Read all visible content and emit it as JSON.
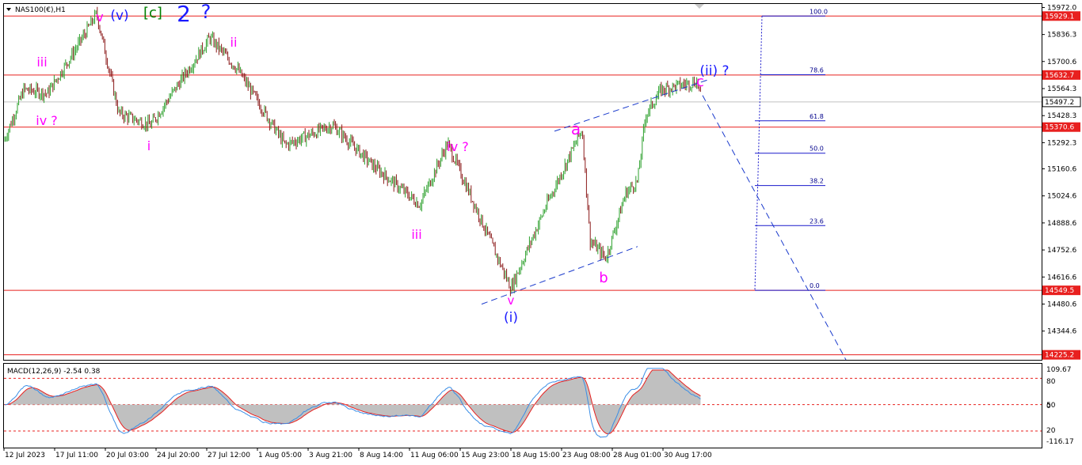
{
  "chart_data": {
    "type": "candlestick",
    "symbol_label": "NAS100(€),H1",
    "title_annotation": {
      "parts": [
        {
          "text": "v",
          "color": "#ff00ff"
        },
        {
          "text": "(v)",
          "color": "#1a1aff"
        },
        {
          "text": "[c]",
          "color": "#008000"
        },
        {
          "text": "2",
          "color": "#1a1aff"
        },
        {
          "text": "?",
          "color": "#1a1aff"
        }
      ]
    },
    "x_tick_labels": [
      "12 Jul 2023",
      "17 Jul 11:00",
      "20 Jul 03:00",
      "24 Jul 20:00",
      "27 Jul 12:00",
      "1 Aug 05:00",
      "3 Aug 21:00",
      "8 Aug 14:00",
      "11 Aug 06:00",
      "15 Aug 23:00",
      "18 Aug 15:00",
      "23 Aug 08:00",
      "28 Aug 01:00",
      "30 Aug 17:00"
    ],
    "y_ticks": [
      15972.0,
      15836.3,
      15700.6,
      15564.3,
      15428.3,
      15292.3,
      15160.6,
      15024.6,
      14888.6,
      14752.6,
      14616.6,
      14480.6,
      14344.6
    ],
    "y_tick_labels": [
      "15972.0",
      "15836.3",
      "15700.6",
      "15564.3",
      "15428.3",
      "15292.3",
      "15160.6",
      "15024.6",
      "14888.6",
      "14752.6",
      "14616.6",
      "14480.6",
      "14344.6"
    ],
    "ylim": [
      14200,
      15990
    ],
    "horizontal_levels": [
      {
        "value": 15929.1,
        "label": "15929.1",
        "color": "#e8201f"
      },
      {
        "value": 15632.7,
        "label": "15632.7",
        "color": "#e8201f"
      },
      {
        "value": 15370.6,
        "label": "15370.6",
        "color": "#e8201f"
      },
      {
        "value": 14549.5,
        "label": "14549.5",
        "color": "#e8201f"
      },
      {
        "value": 14225.2,
        "label": "14225.2",
        "color": "#e8201f"
      }
    ],
    "current_price": {
      "value": 15497.2,
      "label": "15497.2"
    },
    "fibonacci": {
      "high": 15929.1,
      "low": 14549.5,
      "levels": [
        {
          "ratio": 100.0,
          "label": "100.0"
        },
        {
          "ratio": 78.6,
          "label": "78.6"
        },
        {
          "ratio": 61.8,
          "label": "61.8"
        },
        {
          "ratio": 50.0,
          "label": "50.0"
        },
        {
          "ratio": 38.2,
          "label": "38.2"
        },
        {
          "ratio": 23.6,
          "label": "23.6"
        },
        {
          "ratio": 0.0,
          "label": "0.0"
        }
      ]
    },
    "wave_labels": [
      {
        "text": "iii",
        "color": "#ff00ff",
        "near": "17 Jul high"
      },
      {
        "text": "iv ?",
        "color": "#ff00ff",
        "near": "14 Jul low"
      },
      {
        "text": "i",
        "color": "#ff00ff",
        "near": "24 Jul low"
      },
      {
        "text": "ii",
        "color": "#ff00ff",
        "near": "27 Jul high"
      },
      {
        "text": "iv ?",
        "color": "#ff00ff",
        "near": "14 Aug high"
      },
      {
        "text": "iii",
        "color": "#ff00ff",
        "near": "11 Aug low"
      },
      {
        "text": "v",
        "color": "#ff00ff",
        "near": "18 Aug low"
      },
      {
        "text": "(i)",
        "color": "#1a1aff",
        "near": "18 Aug low"
      },
      {
        "text": "a",
        "color": "#ff00ff",
        "near": "23 Aug high"
      },
      {
        "text": "b",
        "color": "#ff00ff",
        "near": "25 Aug low"
      },
      {
        "text": "c",
        "color": "#ff00ff",
        "near": "1 Sep high"
      },
      {
        "text": "(ii) ?",
        "color": "#1a1aff",
        "near": "1 Sep high"
      }
    ],
    "path_keypoints": [
      {
        "x": "12 Jul 2023",
        "y": 15300
      },
      {
        "x": "13 Jul",
        "y": 15560
      },
      {
        "x": "14 Jul",
        "y": 15540
      },
      {
        "x": "17 Jul",
        "y": 15760
      },
      {
        "x": "18 Jul",
        "y": 15940
      },
      {
        "x": "20 Jul",
        "y": 15440
      },
      {
        "x": "24 Jul",
        "y": 15380
      },
      {
        "x": "27 Jul",
        "y": 15820
      },
      {
        "x": "31 Jul",
        "y": 15660
      },
      {
        "x": "2 Aug",
        "y": 15280
      },
      {
        "x": "4 Aug",
        "y": 15380
      },
      {
        "x": "8 Aug",
        "y": 15180
      },
      {
        "x": "11 Aug",
        "y": 14980
      },
      {
        "x": "14 Aug",
        "y": 15290
      },
      {
        "x": "16 Aug",
        "y": 14880
      },
      {
        "x": "18 Aug",
        "y": 14560
      },
      {
        "x": "21 Aug",
        "y": 14980
      },
      {
        "x": "23 Aug",
        "y": 15360
      },
      {
        "x": "24 Aug",
        "y": 14800
      },
      {
        "x": "25 Aug",
        "y": 14710
      },
      {
        "x": "28 Aug",
        "y": 15040
      },
      {
        "x": "29 Aug",
        "y": 15100
      },
      {
        "x": "30 Aug",
        "y": 15430
      },
      {
        "x": "31 Aug",
        "y": 15560
      },
      {
        "x": "1 Sep",
        "y": 15600
      },
      {
        "x": "1 Sep 17:00",
        "y": 15480
      }
    ],
    "macd": {
      "label": "MACD(12,26,9) -2.54 0.38",
      "y_ticks": [
        109.67,
        80,
        50,
        0,
        20,
        -116.17
      ],
      "y_tick_labels": [
        "109.67",
        "80",
        "50",
        "0",
        "20",
        "-116.17"
      ],
      "ylim": [
        -116.17,
        109.67
      ],
      "levels": [
        80,
        0,
        -80
      ],
      "current": {
        "macd": -2.54,
        "signal": 0.38
      }
    },
    "colors": {
      "bull_candle": "#2ca02c",
      "bear_candle": "#8b1a1a",
      "level_line": "#e8201f",
      "fib": "#1a1acc",
      "trendline": "#1a3acc",
      "macd_hist": "#c0c0c0",
      "macd_signal": "#e8201f",
      "macd_line": "#3a8ee6"
    }
  }
}
